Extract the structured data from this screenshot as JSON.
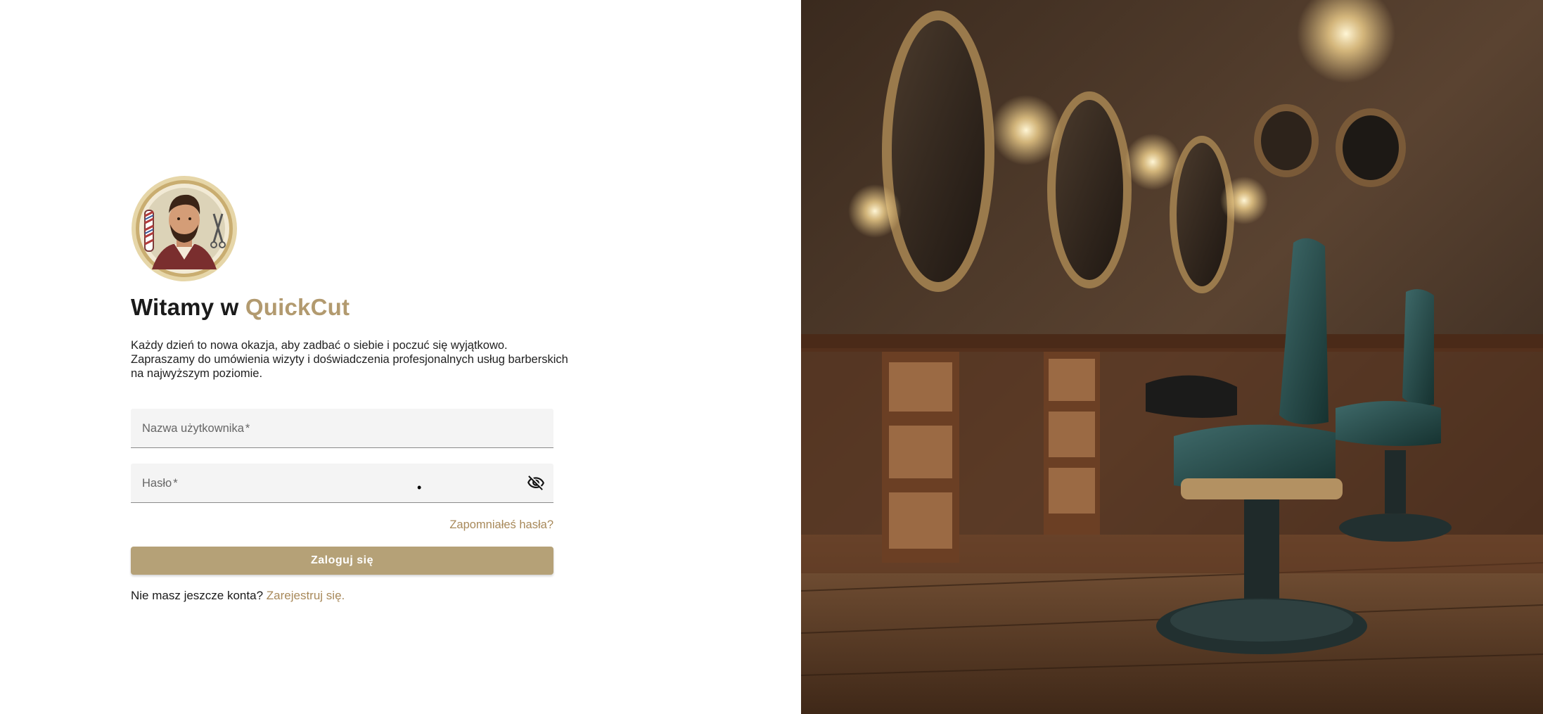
{
  "welcome": {
    "prefix": "Witamy w ",
    "brand": "QuickCut"
  },
  "intro": {
    "line1": "Każdy dzień to nowa okazja, aby zadbać o siebie i poczuć się wyjątkowo.",
    "line2": "Zapraszamy do umówienia wizyty i doświadczenia profesjonalnych usług barberskich",
    "line3": "na najwyższym poziomie."
  },
  "form": {
    "username_label": "Nazwa użytkownika",
    "password_label": "Hasło",
    "required_mark": "*",
    "forgot_password": "Zapomniałeś hasła?",
    "login_button": "Zaloguj się"
  },
  "register": {
    "prompt": "Nie masz jeszcze konta?",
    "link": "Zarejestruj się."
  },
  "icons": {
    "logo": "barber-logo",
    "password_toggle": "eye-off-icon"
  },
  "colors": {
    "accent": "#b29a6f",
    "button": "#b5a177",
    "link": "#a8895a"
  }
}
